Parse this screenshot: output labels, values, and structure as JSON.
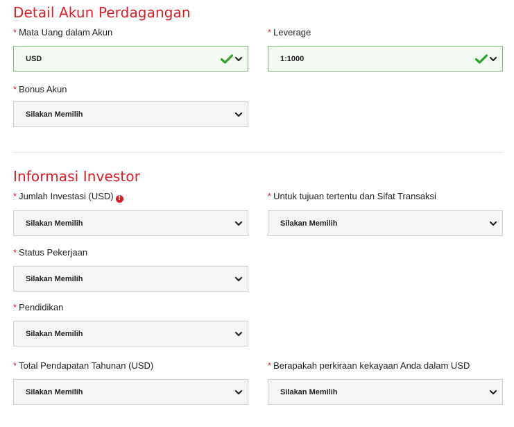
{
  "account_details": {
    "title": "Detail Akun Perdagangan",
    "currency": {
      "label": "Mata Uang dalam Akun",
      "value": "USD"
    },
    "leverage": {
      "label": "Leverage",
      "value": "1:1000"
    },
    "bonus": {
      "label": "Bonus Akun",
      "value": "Silakan Memilih"
    }
  },
  "investor_info": {
    "title": "Informasi Investor",
    "investment_amount": {
      "label": "Jumlah Investasi (USD)",
      "value": "Silakan Memilih"
    },
    "transaction_purpose": {
      "label": "Untuk tujuan tertentu dan Sifat Transaksi",
      "value": "Silakan Memilih"
    },
    "employment_status": {
      "label": "Status Pekerjaan",
      "value": "Silakan Memilih"
    },
    "education": {
      "label": "Pendidikan",
      "value": "Silakan Memilih"
    },
    "annual_income": {
      "label": "Total Pendapatan Tahunan (USD)",
      "value": "Silakan Memilih"
    },
    "net_worth": {
      "label": "Berapakah perkiraan kekayaan Anda dalam USD",
      "value": "Silakan Memilih"
    }
  },
  "required_marker": "*",
  "icons": {
    "valid": "checkmark-icon",
    "dropdown": "chevron-down-icon",
    "info": "info-icon"
  },
  "colors": {
    "accent": "#d71c24",
    "valid_border": "#7fb87a",
    "check": "#2aa52a"
  }
}
